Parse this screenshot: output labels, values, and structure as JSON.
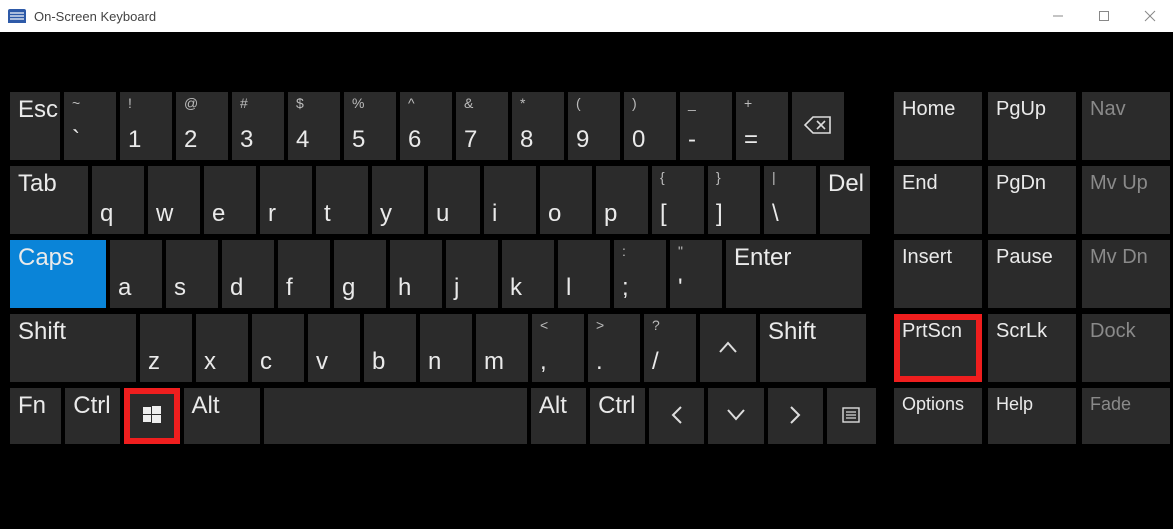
{
  "window": {
    "title": "On-Screen Keyboard"
  },
  "row1": {
    "esc": "Esc",
    "tilde_u": "~",
    "tilde_l": "`",
    "k1_u": "!",
    "k1_l": "1",
    "k2_u": "@",
    "k2_l": "2",
    "k3_u": "#",
    "k3_l": "3",
    "k4_u": "$",
    "k4_l": "4",
    "k5_u": "%",
    "k5_l": "5",
    "k6_u": "^",
    "k6_l": "6",
    "k7_u": "&",
    "k7_l": "7",
    "k8_u": "*",
    "k8_l": "8",
    "k9_u": "(",
    "k9_l": "9",
    "k0_u": ")",
    "k0_l": "0",
    "minus_u": "_",
    "minus_l": "-",
    "eq_u": "+",
    "eq_l": "="
  },
  "row2": {
    "tab": "Tab",
    "q": "q",
    "w": "w",
    "e": "e",
    "r": "r",
    "t": "t",
    "y": "y",
    "u": "u",
    "i": "i",
    "o": "o",
    "p": "p",
    "lb_u": "{",
    "lb_l": "[",
    "rb_u": "}",
    "rb_l": "]",
    "bsl_u": "|",
    "bsl_l": "\\",
    "del": "Del"
  },
  "row3": {
    "caps": "Caps",
    "a": "a",
    "s": "s",
    "d": "d",
    "f": "f",
    "g": "g",
    "h": "h",
    "j": "j",
    "k": "k",
    "l": "l",
    "sc_u": ":",
    "sc_l": ";",
    "qt_u": "\"",
    "qt_l": "'",
    "enter": "Enter"
  },
  "row4": {
    "shift": "Shift",
    "z": "z",
    "x": "x",
    "c": "c",
    "v": "v",
    "b": "b",
    "n": "n",
    "m": "m",
    "cm_u": "<",
    "cm_l": ",",
    "pd_u": ">",
    "pd_l": ".",
    "sl_u": "?",
    "sl_l": "/",
    "shift2": "Shift"
  },
  "row5": {
    "fn": "Fn",
    "ctrl": "Ctrl",
    "alt": "Alt",
    "alt2": "Alt",
    "ctrl2": "Ctrl"
  },
  "side": {
    "home": "Home",
    "pgup": "PgUp",
    "nav": "Nav",
    "end": "End",
    "pgdn": "PgDn",
    "mvup": "Mv Up",
    "insert": "Insert",
    "pause": "Pause",
    "mvdn": "Mv Dn",
    "prtscn": "PrtScn",
    "scrlk": "ScrLk",
    "dock": "Dock",
    "options": "Options",
    "help": "Help",
    "fade": "Fade"
  }
}
